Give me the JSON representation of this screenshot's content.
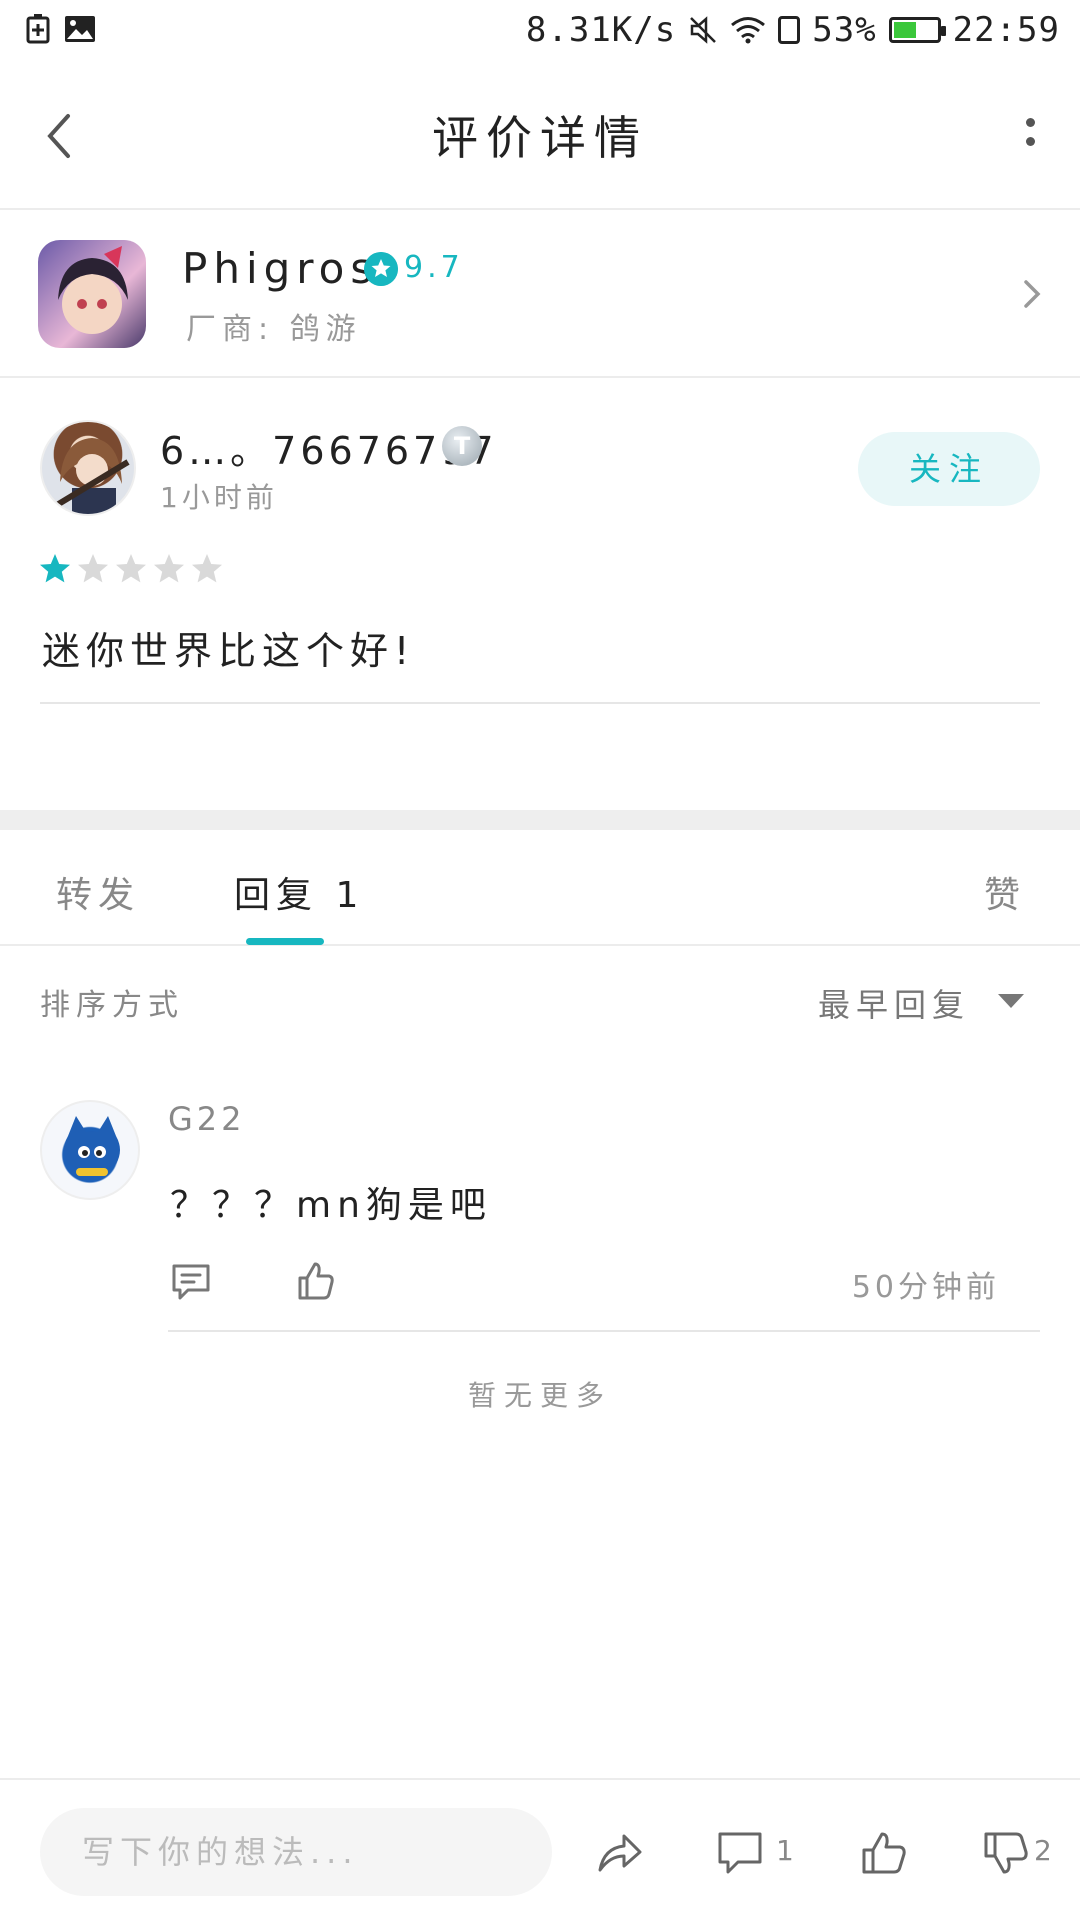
{
  "status_bar": {
    "speed": "8.31K/s",
    "battery": "53%",
    "battery_level": 0.53,
    "time": "22:59"
  },
  "header": {
    "title": "评价详情"
  },
  "game": {
    "name": "Phigros",
    "score": "9.7",
    "vendor": "厂商: 鸽游"
  },
  "review": {
    "user_name": "6…。76676797",
    "level": "T",
    "time": "1小时前",
    "follow_label": "关注",
    "rating": 1,
    "rating_max": 5,
    "text": "迷你世界比这个好!"
  },
  "tabs": [
    {
      "label": "转发",
      "active": false
    },
    {
      "label": "回复 1",
      "active": true
    },
    {
      "label": "赞",
      "active": false
    }
  ],
  "sort": {
    "label": "排序方式",
    "value": "最早回复"
  },
  "replies": [
    {
      "name": "G22",
      "text": "？？？mn狗是吧",
      "time": "50分钟前"
    }
  ],
  "no_more": "暂无更多",
  "bottom_bar": {
    "placeholder": "写下你的想法...",
    "comment_count": "1",
    "dislike_count": "2"
  },
  "colors": {
    "accent": "#17b7c0",
    "battery": "#3bc73b"
  }
}
